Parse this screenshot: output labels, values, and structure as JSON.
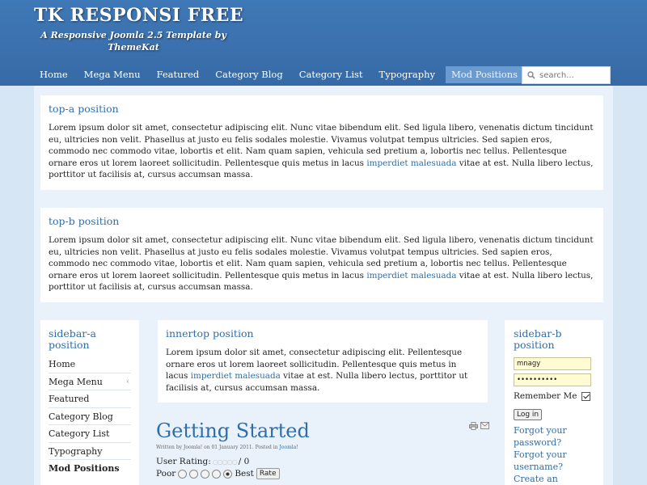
{
  "header": {
    "title": "TK RESPONSI FREE",
    "subtitle": "A Responsive Joomla 2.5 Template by ThemeKat"
  },
  "nav": {
    "items": [
      "Home",
      "Mega Menu",
      "Featured",
      "Category Blog",
      "Category List",
      "Typography",
      "Mod Positions"
    ],
    "active": "Mod Positions"
  },
  "search": {
    "placeholder": "search...",
    "icon": "search-icon"
  },
  "top_a": {
    "title": "top-a position",
    "text_before_link": "Lorem ipsum dolor sit amet, consectetur adipiscing elit. Nunc vitae bibendum elit. Sed ligula libero, venenatis dictum tincidunt eu, ultricies non velit. Phasellus at justo eu felis sodales molestie. Vivamus volutpat tempus ultricies. Sed sapien eros, commodo nec commodo vitae, lobortis et elit. Nam quam sapien, vehicula sed pretium a, lobortis nec tellus. Pellentesque ornare eros ut lorem laoreet sollicitudin. Pellentesque quis metus in lacus ",
    "link": "imperdiet malesuada",
    "text_after_link": " vitae at est. Nulla libero lectus, porttitor ut facilisis at, cursus accumsan massa."
  },
  "top_b": {
    "title": "top-b position",
    "text_before_link": "Lorem ipsum dolor sit amet, consectetur adipiscing elit. Nunc vitae bibendum elit. Sed ligula libero, venenatis dictum tincidunt eu, ultricies non velit. Phasellus at justo eu felis sodales molestie. Vivamus volutpat tempus ultricies. Sed sapien eros, commodo nec commodo vitae, lobortis et elit. Nam quam sapien, vehicula sed pretium a, lobortis nec tellus. Pellentesque ornare eros ut lorem laoreet sollicitudin. Pellentesque quis metus in lacus ",
    "link": "imperdiet malesuada",
    "text_after_link": " vitae at est. Nulla libero lectus, porttitor ut facilisis at, cursus accumsan massa."
  },
  "sidebar_a": {
    "title": "sidebar-a position",
    "menu": [
      "Home",
      "Mega Menu",
      "Featured",
      "Category Blog",
      "Category List",
      "Typography",
      "Mod Positions"
    ]
  },
  "innertop": {
    "title": "innertop position",
    "text_before_link": "Lorem ipsum dolor sit amet, consectetur adipiscing elit.  Pellentesque ornare eros ut lorem laoreet sollicitudin. Pellentesque quis metus in lacus ",
    "link": "imperdiet malesuada",
    "text_after_link": " vitae at est. Nulla libero lectus, porttitor ut facilisis at, cursus accumsan massa."
  },
  "article": {
    "title": "Getting Started",
    "meta_prefix": "Written by Joomla! on 01 January 2011. Posted in ",
    "meta_category": "Joomla!",
    "rating_label": "User Rating:",
    "rating_stars": "○○○○○",
    "rating_suffix": "/ 0",
    "vote_poor": "Poor",
    "vote_best": "Best",
    "rate_button": "Rate",
    "icons": [
      "print-icon",
      "email-icon"
    ]
  },
  "sidebar_b": {
    "title": "sidebar-b position",
    "username": "mnagy",
    "password": "••••••••••",
    "remember_label": "Remember Me",
    "remember_checked": true,
    "login_button": "Log in",
    "forgot_password": "Forgot your password?",
    "forgot_username": "Forgot your username?",
    "create_account": "Create an"
  },
  "colors": {
    "header_bg": "#3a70ad",
    "nav_active_bg": "#6a9bd0",
    "link": "#2f6ea8",
    "page_bg": "#d6e6f4",
    "content_bg": "#e9f2fb"
  }
}
